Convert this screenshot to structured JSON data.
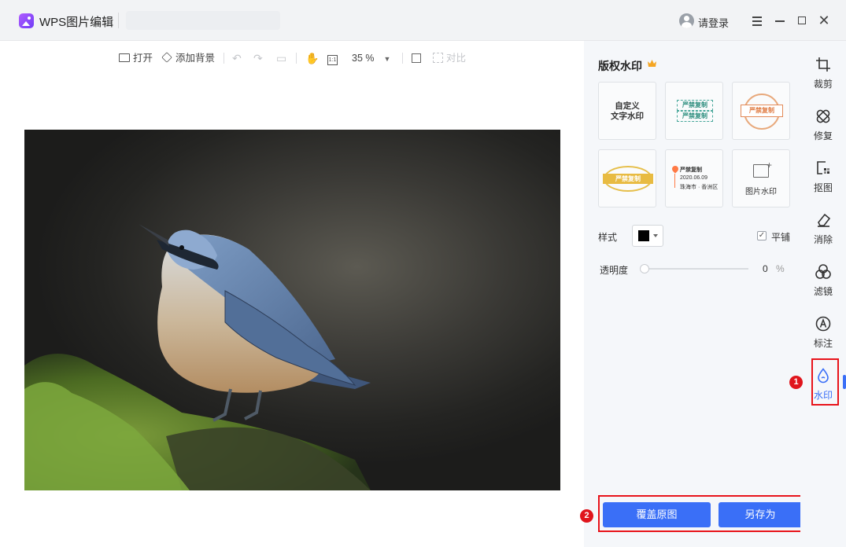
{
  "app": {
    "title": "WPS图片编辑",
    "login": "请登录"
  },
  "toolbar": {
    "open": "打开",
    "add_background": "添加背景",
    "zoom": "35 %",
    "compare": "对比",
    "ratio": "1:1"
  },
  "panel": {
    "title": "版权水印",
    "templates": {
      "custom_text": "自定义\n文字水印",
      "stamp_text": "严禁复制",
      "location_title": "严禁复制",
      "location_date": "2020.06.09",
      "location_place": "珠海市 · 香洲区",
      "image_watermark": "图片水印"
    },
    "style_label": "样式",
    "style_color": "#000000",
    "tile_label": "平铺",
    "tile_checked": "✓",
    "opacity_label": "透明度",
    "opacity_value": "0",
    "opacity_unit": "%",
    "opacity_fraction": 0
  },
  "actions": {
    "overwrite": "覆盖原图",
    "save_as": "另存为"
  },
  "rail": {
    "crop": "裁剪",
    "repair": "修复",
    "cutout": "抠图",
    "erase": "消除",
    "filter": "滤镜",
    "annotate": "标注",
    "watermark": "水印"
  },
  "markers": {
    "first": "1",
    "second": "2"
  },
  "colors": {
    "accent": "#3a6ff7",
    "highlight": "#e8131a"
  }
}
